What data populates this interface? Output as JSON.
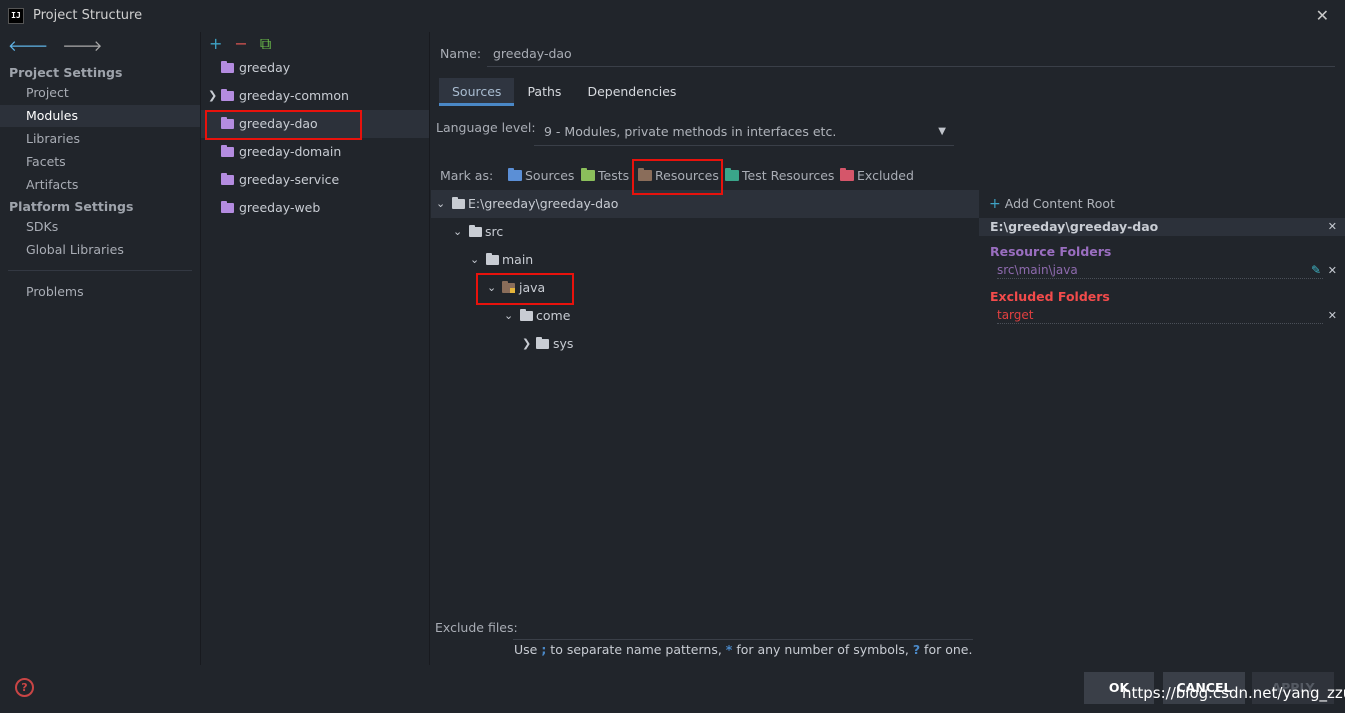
{
  "window": {
    "title": "Project Structure",
    "icon_label": "IJ"
  },
  "nav": {
    "project_settings": "Project Settings",
    "items_project": [
      "Project",
      "Modules",
      "Libraries",
      "Facets",
      "Artifacts"
    ],
    "platform_settings": "Platform Settings",
    "items_platform": [
      "SDKs",
      "Global Libraries"
    ],
    "problems": "Problems",
    "selected": "Modules"
  },
  "modules": {
    "items": [
      "greeday",
      "greeday-common",
      "greeday-dao",
      "greeday-domain",
      "greeday-service",
      "greeday-web"
    ],
    "selected": "greeday-dao"
  },
  "details": {
    "name_label": "Name:",
    "name_value": "greeday-dao",
    "tabs": [
      "Sources",
      "Paths",
      "Dependencies"
    ],
    "active_tab": "Sources",
    "language_label": "Language level:",
    "language_value": "9 - Modules, private methods in interfaces etc.",
    "mark_as_label": "Mark as:",
    "mark_as": [
      "Sources",
      "Tests",
      "Resources",
      "Test Resources",
      "Excluded"
    ],
    "tree": {
      "root": "E:\\greeday\\greeday-dao",
      "src": "src",
      "main": "main",
      "java": "java",
      "come": "come",
      "sys": "sys"
    },
    "exclude_label": "Exclude files:",
    "hint": {
      "p1": "Use ",
      "sep": ";",
      "p2": " to separate name patterns, ",
      "star": "*",
      "p3": " for any number of symbols, ",
      "q": "?",
      "p4": " for one."
    }
  },
  "roots_panel": {
    "add_label": "Add Content Root",
    "root_path": "E:\\greeday\\greeday-dao",
    "resource_title": "Resource Folders",
    "resource_item": "src\\main\\java",
    "excluded_title": "Excluded Folders",
    "excluded_item": "target"
  },
  "footer": {
    "ok": "OK",
    "cancel": "CANCEL",
    "apply": "APPLY",
    "help": "?",
    "watermark": "https://blog.csdn.net/yang_zzu"
  },
  "colors": {
    "bg": "#21252b",
    "selection": "#2c313a",
    "highlight_box": "#e8120c",
    "resource_purple": "#9a6ec0",
    "excluded_red": "#f24b4b",
    "accent_blue": "#4a88c7"
  },
  "icons": {
    "back": "arrow-left-icon",
    "forward": "arrow-right-icon",
    "add": "plus-icon",
    "remove": "minus-icon",
    "copy": "copy-icon",
    "close": "close-icon",
    "edit": "pencil-icon",
    "help": "help-icon"
  }
}
